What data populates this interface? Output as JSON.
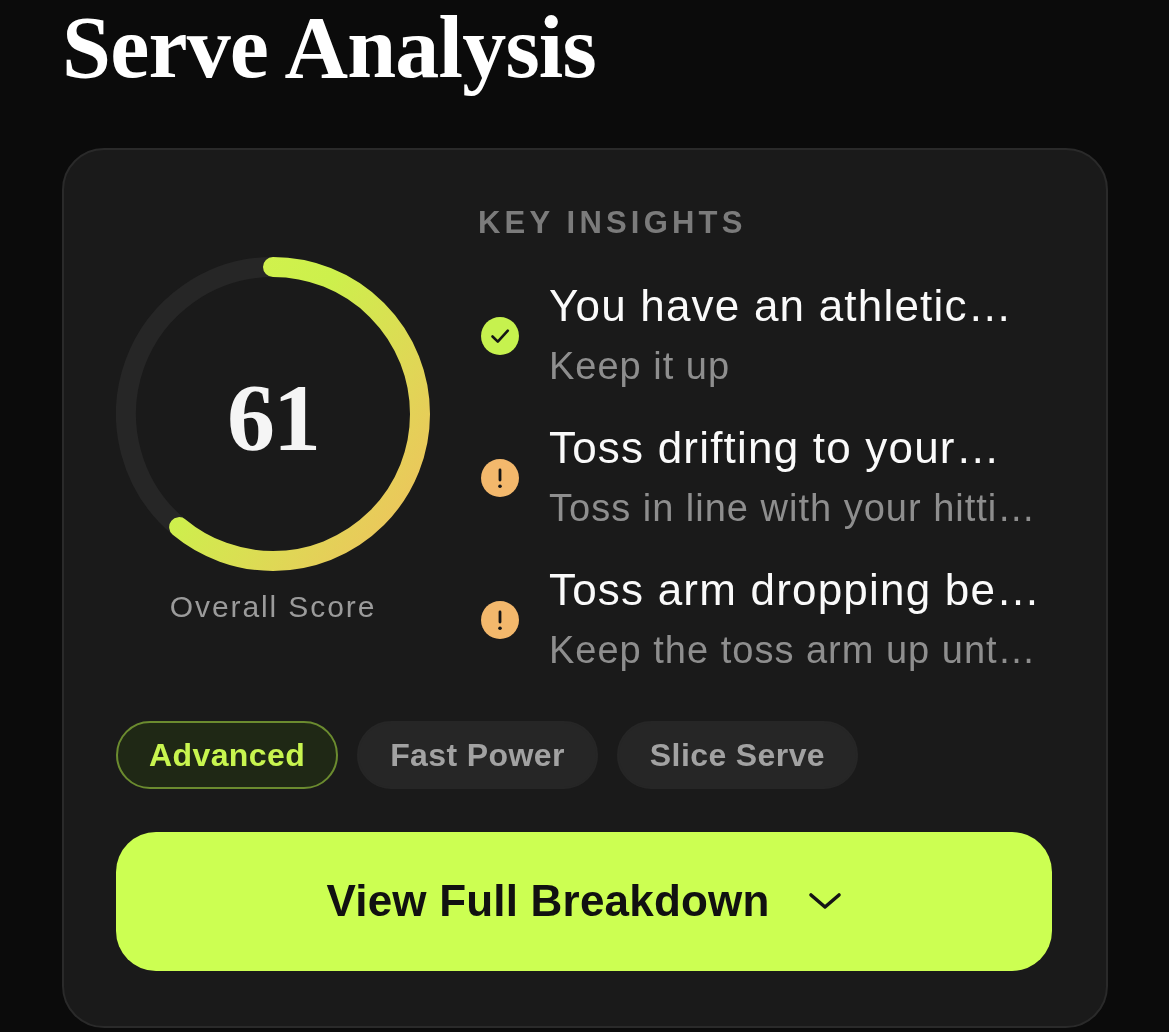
{
  "title": "Serve Analysis",
  "score": {
    "value": "61",
    "label": "Overall Score",
    "level": 0.61
  },
  "insights": {
    "heading": "KEY INSIGHTS",
    "items": [
      {
        "kind": "success",
        "title": "You have an athletic…",
        "detail": "Keep it up"
      },
      {
        "kind": "warning",
        "title": "Toss drifting to your…",
        "detail": "Toss in line with your hitti…"
      },
      {
        "kind": "warning",
        "title": "Toss arm dropping be…",
        "detail": "Keep the toss arm up unt…"
      }
    ]
  },
  "tags": [
    {
      "label": "Advanced",
      "highlighted": true
    },
    {
      "label": "Fast Power",
      "highlighted": false
    },
    {
      "label": "Slice Serve",
      "highlighted": false
    }
  ],
  "button": {
    "label": "View Full Breakdown"
  }
}
